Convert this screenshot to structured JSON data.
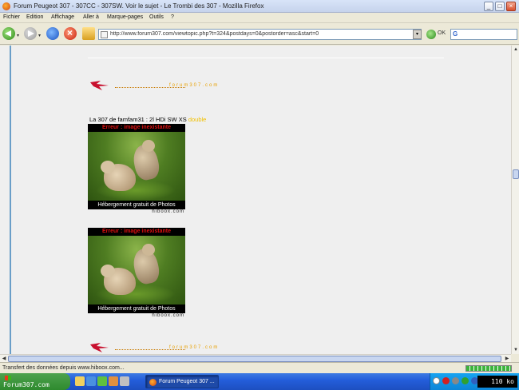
{
  "window": {
    "title": "Forum Peugeot 307 - 307CC - 307SW. Voir le sujet - Le Trombi des 307 - Mozilla Firefox",
    "min_label": "_",
    "max_label": "□",
    "close_label": "×"
  },
  "menu": [
    "Fichier",
    "Edition",
    "Affichage",
    "Aller à",
    "Marque-pages",
    "Outils",
    "?"
  ],
  "toolbar": {
    "url": "http://www.forum307.com/viewtopic.php?t=324&postdays=0&postorder=asc&start=0",
    "go_label": "OK",
    "search_engine": "G",
    "dropdown_glyph": "▾",
    "back_dropdown": "▾",
    "fwd_dropdown": "▾"
  },
  "page": {
    "logo_text": "forum307.com",
    "topic_line_prefix": "La 307 de famfam31 : 2l HDi SW XS",
    "signature": "double",
    "images": [
      {
        "error_text": "Erreur : image inexistante",
        "caption": "Hébergement gratuit de Photos",
        "credit": "hiboox.com"
      },
      {
        "error_text": "Erreur : image inexistante",
        "caption": "Hébergement gratuit de Photos",
        "credit": "hiboox.com"
      }
    ]
  },
  "scrollbar": {
    "up": "▲",
    "down": "▼",
    "left": "◀",
    "right": "▶",
    "mid_glyph": "≡"
  },
  "status": {
    "text": "Transfert des données depuis www.hiboox.com...",
    "progress": 1.0
  },
  "taskbar": {
    "start_label": "Forum307.com",
    "task_title": "Forum Peugeot 307 ...",
    "clock": "110 ko"
  },
  "colors": {
    "accent": "#245edb",
    "logo": "#e8a000",
    "error_text": "#e01010",
    "signature": "#f0c000"
  }
}
